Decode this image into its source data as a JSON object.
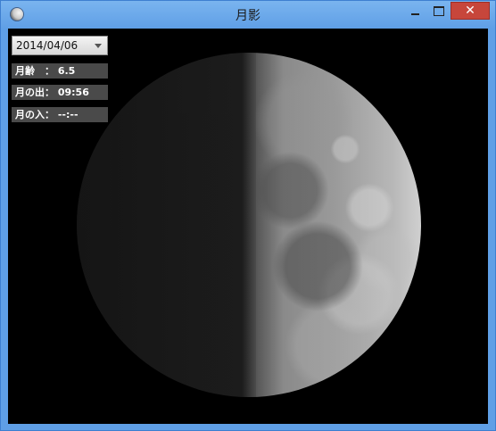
{
  "window": {
    "title": "月影",
    "close_label": "✕"
  },
  "controls": {
    "date_value": "2014/04/06"
  },
  "info": {
    "age_label": "月齢　：",
    "age_value": "6.5",
    "moonrise_label": "月の出：",
    "moonrise_value": "09:56",
    "moonset_label": "月の入：",
    "moonset_value": "--:--"
  },
  "colors": {
    "titlebar": "#5f9fe6",
    "close_button": "#c7463b",
    "background": "#000000",
    "info_panel": "#4a4a4a"
  },
  "icons": {
    "app": "moon-icon",
    "dropdown": "chevron-down-icon"
  }
}
